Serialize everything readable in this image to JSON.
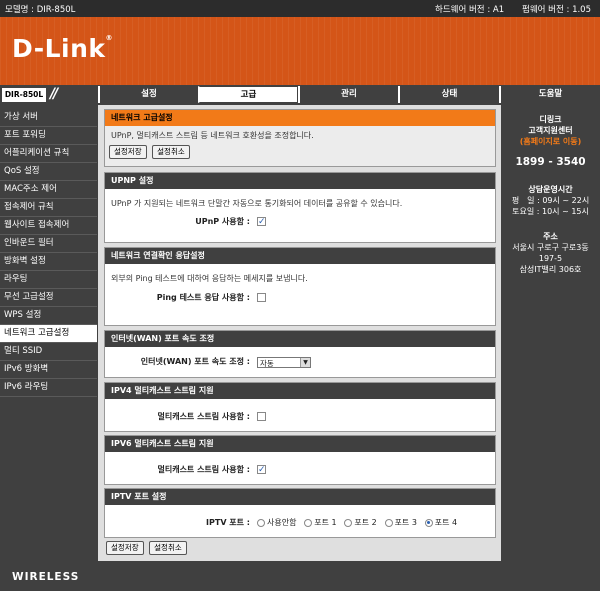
{
  "top": {
    "model": "모델명 : DIR-850L",
    "hw": "하드웨어 버전 : A1",
    "fw": "펌웨어 버전 : 1.05"
  },
  "logo": {
    "text": "D-Link",
    "reg": "®"
  },
  "model_box": "DIR-850L",
  "tabs": [
    {
      "label": "설정"
    },
    {
      "label": "고급"
    },
    {
      "label": "관리"
    },
    {
      "label": "상태"
    },
    {
      "label": "도움말"
    }
  ],
  "sidebar": [
    {
      "label": "가상 서버"
    },
    {
      "label": "포트 포워딩"
    },
    {
      "label": "어플리케이션 규칙"
    },
    {
      "label": "QoS 설정"
    },
    {
      "label": "MAC주소 제어"
    },
    {
      "label": "접속제어 규칙"
    },
    {
      "label": "웹사이트 접속제어"
    },
    {
      "label": "인바운드 필터"
    },
    {
      "label": "방화벽 설정"
    },
    {
      "label": "라우팅"
    },
    {
      "label": "무선 고급설정"
    },
    {
      "label": "WPS 설정"
    },
    {
      "label": "네트워크 고급설정"
    },
    {
      "label": "멀티 SSID"
    },
    {
      "label": "IPv6 방화벽"
    },
    {
      "label": "IPv6 라우팅"
    }
  ],
  "right": {
    "brand": "디링크",
    "center": "고객지원센터",
    "link": "(홈페이지로 이동)",
    "phone": "1899 - 3540",
    "hours_title": "상담운영시간",
    "weekday": "평　일 : 09시 ~ 22시",
    "saturday": "토요일 : 10시 ~ 15시",
    "addr_title": "주소",
    "addr1": "서울시 구로구 구로3동",
    "addr2": "197-5",
    "addr3": "삼성IT밸리 306호"
  },
  "main": {
    "title": "네트워크 고급설정",
    "desc": "UPnP, 멀티캐스트 스트림 등 네트워크 호환성을 조정합니다.",
    "save": "설정저장",
    "cancel": "설정취소",
    "upnp": {
      "head": "UPNP 설정",
      "desc": "UPnP 가 지원되는 네트워크 단말간 자동으로 통기화되어 데이터를 공유할 수 있습니다.",
      "label": "UPnP 사용함 :"
    },
    "ping": {
      "head": "네트워크 연결확인 응답설정",
      "desc": "외부의 Ping 테스트에 대하여 응답하는 메세지를 보냅니다.",
      "label": "Ping 테스트 응답 사용함 :"
    },
    "wan": {
      "head": "인터넷(WAN) 포트 속도 조정",
      "label": "인터넷(WAN) 포트 속도 조정 :",
      "value": "자동"
    },
    "ipv4": {
      "head": "IPV4 멀티캐스트 스트림 지원",
      "label": "멀티캐스트 스트림 사용함 :"
    },
    "ipv6": {
      "head": "IPV6 멀티캐스트 스트림 지원",
      "label": "멀티캐스트 스트림 사용함 :"
    },
    "iptv": {
      "head": "IPTV 포트 설정",
      "label": "IPTV 포트 :",
      "options": [
        "사용안함",
        "포트 1",
        "포트 2",
        "포트 3",
        "포트 4"
      ]
    }
  },
  "footer": "WIRELESS"
}
